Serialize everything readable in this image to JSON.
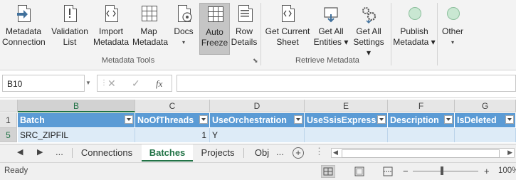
{
  "ribbon": {
    "buttons": [
      {
        "label1": "Metadata",
        "label2": "Connection"
      },
      {
        "label1": "Validation",
        "label2": "List"
      },
      {
        "label1": "Import",
        "label2": "Metadata"
      },
      {
        "label1": "Map",
        "label2": "Metadata"
      },
      {
        "label1": "Docs",
        "label2": "▾"
      },
      {
        "label1": "Auto",
        "label2": "Freeze"
      },
      {
        "label1": "Row",
        "label2": "Details"
      },
      {
        "label1": "Get Current",
        "label2": "Sheet"
      },
      {
        "label1": "Get All",
        "label2": "Entities ▾"
      },
      {
        "label1": "Get All",
        "label2": "Settings ▾"
      },
      {
        "label1": "Publish",
        "label2": "Metadata ▾"
      },
      {
        "label1": "Other",
        "label2": "▾"
      }
    ],
    "groups": {
      "metadata_tools": "Metadata Tools",
      "retrieve_metadata": "Retrieve Metadata"
    }
  },
  "formula_bar": {
    "name_box": "B10",
    "fx": "fx",
    "value": ""
  },
  "grid": {
    "columns": [
      "B",
      "C",
      "D",
      "E",
      "F",
      "G"
    ],
    "headers": [
      "Batch",
      "NoOfThreads",
      "UseOrchestration",
      "UseSsisExpress",
      "Description",
      "IsDeleted"
    ],
    "row_numbers": [
      "1",
      "5"
    ],
    "row": [
      "SRC_ZIPFIL",
      "1",
      "Y",
      "",
      "",
      ""
    ]
  },
  "sheet_tabs": {
    "ellipsis_left": "...",
    "tabs": [
      "Connections",
      "Batches",
      "Projects",
      "Obj"
    ],
    "ellipsis_right": "...",
    "active": "Batches"
  },
  "status_bar": {
    "ready": "Ready",
    "zoom": "100%",
    "minus": "−",
    "plus": "+"
  }
}
